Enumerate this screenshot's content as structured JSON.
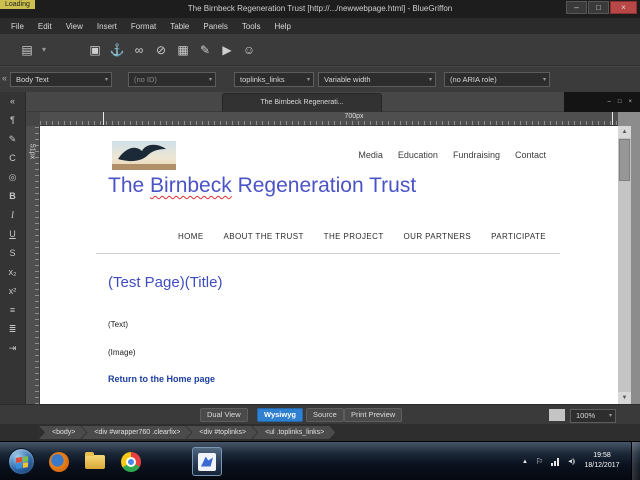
{
  "window": {
    "loading_badge": "Loading",
    "title": "The Birnbeck Regeneration Trust [http://.../newwebpage.html] - BlueGriffon",
    "minimize": "–",
    "maximize": "□",
    "close": "×"
  },
  "menubar": {
    "items": [
      "File",
      "Edit",
      "View",
      "Insert",
      "Format",
      "Table",
      "Panels",
      "Tools",
      "Help"
    ]
  },
  "main_toolbar": {
    "icons": [
      {
        "name": "new-document",
        "glyph": "▤"
      },
      {
        "name": "new-caret",
        "glyph": "▾"
      },
      {
        "name": "paste",
        "glyph": "▣"
      },
      {
        "name": "anchor",
        "glyph": "⚓"
      },
      {
        "name": "link",
        "glyph": "∞"
      },
      {
        "name": "unlink",
        "glyph": "⊘"
      },
      {
        "name": "image",
        "glyph": "▦"
      },
      {
        "name": "edit",
        "glyph": "✎"
      },
      {
        "name": "video",
        "glyph": "▶"
      },
      {
        "name": "emoticon",
        "glyph": "☺"
      }
    ]
  },
  "format_toolbar": {
    "collapse_glyph": "«",
    "caret": "▾",
    "paragraph_format": "Body Text",
    "element_id": "(no ID)",
    "css_class": "toplinks_links",
    "width_mode": "Variable width",
    "aria_role": "(no ARIA role)"
  },
  "tabbar": {
    "active_tab": "The Birnbeck Regenerati...",
    "minimize": "–",
    "restore": "□",
    "close": "×"
  },
  "rulers": {
    "horizontal": "700px",
    "vertical": "51px"
  },
  "left_toolbar": {
    "items": [
      {
        "name": "collapse",
        "glyph": "«"
      },
      {
        "name": "paragraph",
        "glyph": "¶"
      },
      {
        "name": "pencil",
        "glyph": "✎"
      },
      {
        "name": "code",
        "glyph": "C"
      },
      {
        "name": "spellcheck",
        "glyph": "◎"
      },
      {
        "name": "bold",
        "glyph": "B"
      },
      {
        "name": "italic",
        "glyph": "I"
      },
      {
        "name": "underline",
        "glyph": "U"
      },
      {
        "name": "strikethrough",
        "glyph": "S"
      },
      {
        "name": "subscript",
        "glyph": "x₂"
      },
      {
        "name": "superscript",
        "glyph": "x²"
      },
      {
        "name": "bullet-list",
        "glyph": "≡"
      },
      {
        "name": "numbered-list",
        "glyph": "≣"
      },
      {
        "name": "indent",
        "glyph": "⇥"
      }
    ]
  },
  "document": {
    "top_links": [
      "Media",
      "Education",
      "Fundraising",
      "Contact"
    ],
    "title_pre": "The ",
    "title_misspelled": "Birnbeck",
    "title_post": " Regeneration Trust",
    "nav": [
      "HOME",
      "ABOUT THE TRUST",
      "THE PROJECT",
      "OUR PARTNERS",
      "PARTICIPATE"
    ],
    "heading": "(Test Page)(Title)",
    "text_placeholder": "(Text)",
    "image_placeholder": "(Image)",
    "home_link": "Return to the Home page"
  },
  "view_bar": {
    "dual_view": "Dual View",
    "wysiwyg": "Wysiwyg",
    "source": "Source",
    "print_preview": "Print Preview",
    "zoom": "100%"
  },
  "statusbar": {
    "path": [
      "<body>",
      "<div #wrapper760 .clearfix>",
      "<div #toplinks>",
      "<ul .toplinks_links>"
    ]
  },
  "taskbar": {
    "time": "19:58",
    "date": "18/12/2017"
  },
  "colors": {
    "wysiwyg_active": "#2f80d0",
    "site_title": "#4b54c6",
    "page_heading": "#3f4dc0",
    "home_link": "#1c3f9e"
  }
}
